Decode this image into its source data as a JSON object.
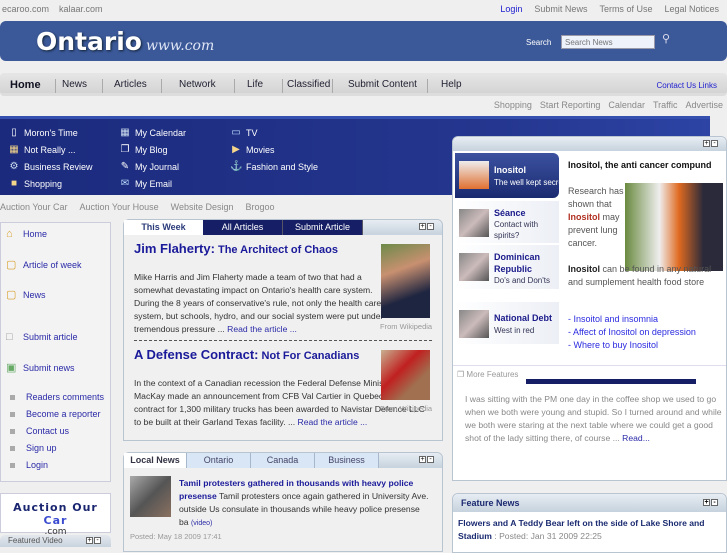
{
  "topbar": {
    "left": [
      "ecaroo.com",
      "kalaar.com"
    ],
    "login": "Login",
    "right": [
      "Submit News",
      "Terms of Use",
      "Legal Notices"
    ]
  },
  "header": {
    "logo": "Ontario",
    "logo_suffix": "www.com",
    "search_label": "Search",
    "search_placeholder": "Search News"
  },
  "nav": {
    "items": [
      "Home",
      "News",
      "Articles",
      "Network",
      "Life",
      "Classified",
      "Submit Content",
      "Help"
    ],
    "contact": "Contact Us",
    "links": "Links"
  },
  "subnav": [
    "Shopping",
    "Start Reporting",
    "Calendar",
    "Traffic",
    "Advertise"
  ],
  "menu": [
    [
      "Moron's Time",
      "Not Really ...",
      "Business Review",
      "Shopping"
    ],
    [
      "My Calendar",
      "My Blog",
      "My Journal",
      "My Email"
    ],
    [
      "TV",
      "Movies",
      "Fashion and Style"
    ]
  ],
  "links2": [
    "Auction Your Car",
    "Auction Your House",
    "Website Design",
    "Brogoo"
  ],
  "sidebar": {
    "main": [
      "Home",
      "Article of week",
      "News",
      "Submit article",
      "Submit news"
    ],
    "bullets": [
      "Readers comments",
      "Become a reporter",
      "Contact us",
      "Sign up",
      "Login"
    ]
  },
  "ad": {
    "a": "Auction Our ",
    "b": "Car",
    "c": ".com"
  },
  "featured_video": "Featured Video",
  "week": {
    "tabs": [
      "This Week",
      "All Articles",
      "Submit Article"
    ],
    "a1": {
      "title": "Jim Flaherty:",
      "sub": " The Architect of Chaos",
      "body": "Mike Harris and Jim Flaherty made a team of two that had a somewhat devastating impact on Ontario's health care system. During the 8 years of conservative's rule, not only the health care system, but schools, hydro, and our social system were put under tremendous pressure ... ",
      "read": "Read the article ...",
      "cap": "From Wikipedia"
    },
    "a2": {
      "title": "A Defense Contract:",
      "sub": " Not For Canadians",
      "body": "In the context of a Canadian recession the Federal Defense Minister Peter MacKay made an announcement from CFB Val Cartier in Quebec, that the contract for 1,300 military trucks has been awarded to Navistar Defence LLC to be built at their Garland Texas facility. ... ",
      "read": "Read the article ...",
      "cap": "From Wikipedia"
    }
  },
  "local": {
    "tabs": [
      "Local News",
      "Ontario",
      "Canada",
      "Business"
    ],
    "title": "Tamil protesters gathered in thousands with heavy police presense",
    "body": " Tamil protesters once again gathered in University Ave. outside Us consulate in thousands while heavy police presense ba ",
    "video": "(video)",
    "posted": "Posted: May 18 2009 17:41"
  },
  "features": {
    "items": [
      {
        "title": "Inositol",
        "sub": "The well kept secret"
      },
      {
        "title": "Séance",
        "sub": "Contact with spirits?"
      },
      {
        "title": "Dominican Republic",
        "sub": "Do's and Don'ts"
      },
      {
        "title": "National Debt",
        "sub": "West in red"
      }
    ],
    "heading": "Inositol, the anti cancer compund",
    "p1a": "Research has shown that ",
    "p1b": "Inositol",
    "p1c": " may prevent lung cancer.",
    "p2a": "Inositol",
    "p2b": " can be found in any natural and sumplement health food store",
    "links": [
      "- Insoitol and insomnia",
      "- Affect of Inositol on depression",
      "- Where to buy Inositol"
    ],
    "more": "More Features"
  },
  "story": {
    "body": "I was sitting with the PM one day in the coffee shop we used to go when we both were young and stupid. So I turned around and while we both were staring at the next table where we could get a good shot of the lady sitting there, of course ... ",
    "read": "Read..."
  },
  "feature_news": {
    "title": "Feature News",
    "headline": "Flowers and A Teddy Bear left on the side of Lake Shore and Stadium",
    "posted": " : Posted: Jan 31 2009 22:25"
  }
}
